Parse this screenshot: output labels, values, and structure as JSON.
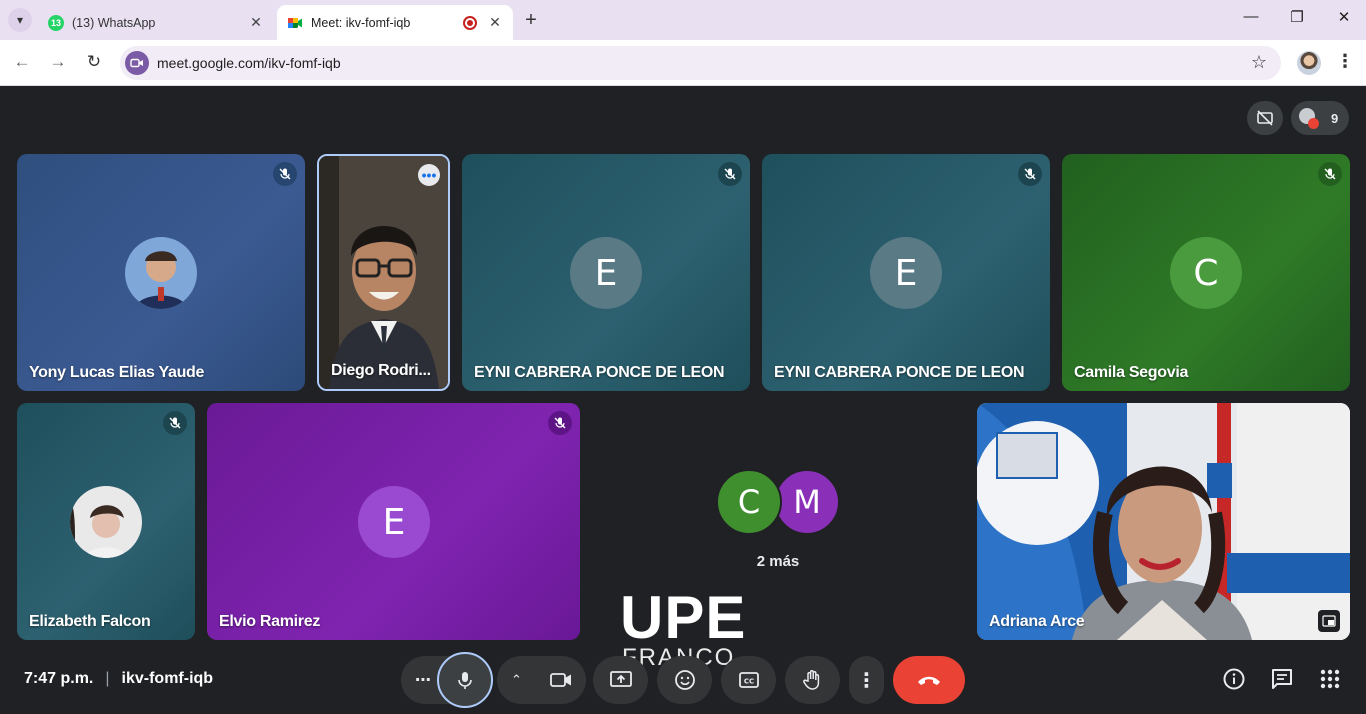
{
  "browser": {
    "tabs": [
      {
        "title": "(13) WhatsApp",
        "badge": "13",
        "active": false
      },
      {
        "title": "Meet: ikv-fomf-iqb",
        "active": true
      }
    ],
    "url": "meet.google.com/ikv-fomf-iqb"
  },
  "meet": {
    "participants_count": "9",
    "tiles": [
      {
        "name": "Yony Lucas Elias Yaude",
        "muted": true
      },
      {
        "name": "Diego Rodri...",
        "muted": false
      },
      {
        "name": "EYNI CABRERA PONCE DE LEON",
        "initial": "E",
        "muted": true
      },
      {
        "name": "EYNI CABRERA PONCE DE LEON",
        "initial": "E",
        "muted": true
      },
      {
        "name": "Camila Segovia",
        "initial": "C",
        "muted": true
      },
      {
        "name": "Elizabeth Falcon",
        "muted": true
      },
      {
        "name": "Elvio Ramirez",
        "initial": "E",
        "muted": true
      },
      {
        "name": "Adriana Arce",
        "muted": false
      }
    ],
    "more": {
      "initials": [
        "C",
        "M"
      ],
      "label": "2 más"
    },
    "watermark": {
      "line1": "UPE",
      "line2": "FRANCO"
    },
    "bottom": {
      "time": "7:47 p.m.",
      "meeting_code": "ikv-fomf-iqb"
    }
  },
  "colors": {
    "stage_bg": "#202124",
    "end_call": "#ea4335",
    "tile_teal": "#2d6170",
    "tile_green": "#2f7a27",
    "tile_purple": "#7f24b0",
    "tile_blue": "#3b5a92"
  }
}
